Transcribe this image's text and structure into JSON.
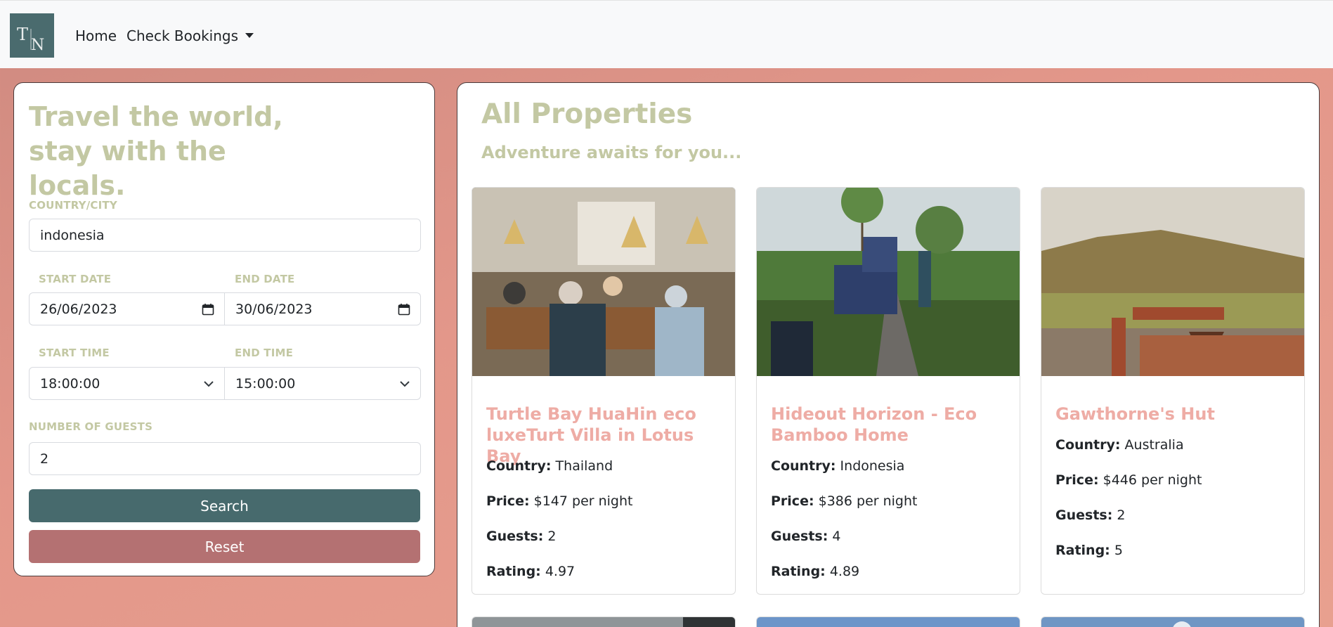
{
  "navbar": {
    "logo_text": "TN",
    "home_label": "Home",
    "bookings_label": "Check Bookings"
  },
  "search": {
    "tagline": "Travel the world, stay with the locals.",
    "country_label": "COUNTRY/CITY",
    "country_value": "indonesia",
    "start_date_label": "START DATE",
    "start_date_value": "26/06/2023",
    "end_date_label": "END DATE",
    "end_date_value": "30/06/2023",
    "start_time_label": "START TIME",
    "start_time_value": "18:00:00",
    "end_time_label": "END TIME",
    "end_time_value": "15:00:00",
    "guests_label": "NUMBER OF GUESTS",
    "guests_value": "2",
    "search_button": "Search",
    "reset_button": "Reset"
  },
  "properties": {
    "title": "All Properties",
    "subtitle": "Adventure awaits for you...",
    "field_labels": {
      "country": "Country:",
      "price": "Price:",
      "guests": "Guests:",
      "rating": "Rating:"
    },
    "cards": [
      {
        "title": "Turtle Bay HuaHin eco luxeTurt Villa in Lotus Bay",
        "country": "Thailand",
        "price": "$147 per night",
        "guests": "2",
        "rating": "4.97"
      },
      {
        "title": "Hideout Horizon - Eco Bamboo Home",
        "country": "Indonesia",
        "price": "$386 per night",
        "guests": "4",
        "rating": "4.89"
      },
      {
        "title": "Gawthorne's Hut",
        "country": "Australia",
        "price": "$446 per night",
        "guests": "2",
        "rating": "5"
      }
    ]
  },
  "colors": {
    "accent_green": "#c3c8a3",
    "title_pink": "#eeaca5",
    "search_button": "#476a6d",
    "reset_button": "#b47172",
    "logo_bg": "#4a6b6e"
  },
  "icons": [
    "calendar-icon",
    "chevron-down-icon",
    "caret-down-icon"
  ]
}
